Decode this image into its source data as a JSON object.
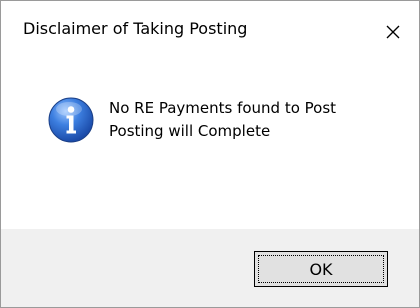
{
  "dialog": {
    "title": "Disclaimer of Taking Posting",
    "close_icon": "close-icon",
    "message_icon": "info-icon",
    "message_lines": [
      "No RE Payments found to Post",
      "Posting will Complete"
    ],
    "ok_label": "OK"
  },
  "colors": {
    "footer_background": "#f0f0f0",
    "button_background": "#e1e1e1",
    "icon_blue": "#1f5fbf"
  }
}
